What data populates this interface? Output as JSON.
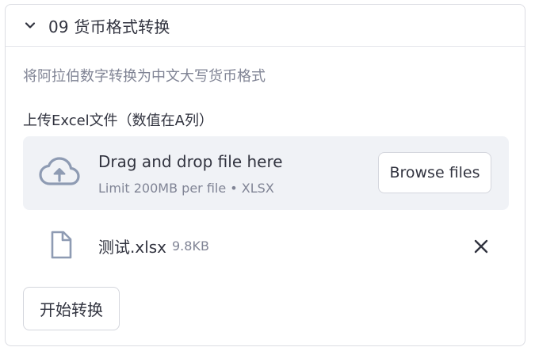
{
  "expander": {
    "title": "09 货币格式转换",
    "expanded": true
  },
  "description": "将阿拉伯数字转换为中文大写货币格式",
  "uploader": {
    "label": "上传Excel文件（数值在A列）",
    "drop_text": "Drag and drop file here",
    "limit_text": "Limit 200MB per file • XLSX",
    "browse_label": "Browse files",
    "icon": "cloud-upload-icon"
  },
  "uploaded_file": {
    "name": "测试.xlsx",
    "size": "9.8KB",
    "icon": "file-icon",
    "remove_icon": "close-icon"
  },
  "convert_button": {
    "label": "开始转换"
  },
  "colors": {
    "text": "#31333f",
    "muted": "#808495",
    "dropzone_bg": "#f0f2f6",
    "border": "#dcdde3",
    "icon": "#8e9bb3"
  }
}
